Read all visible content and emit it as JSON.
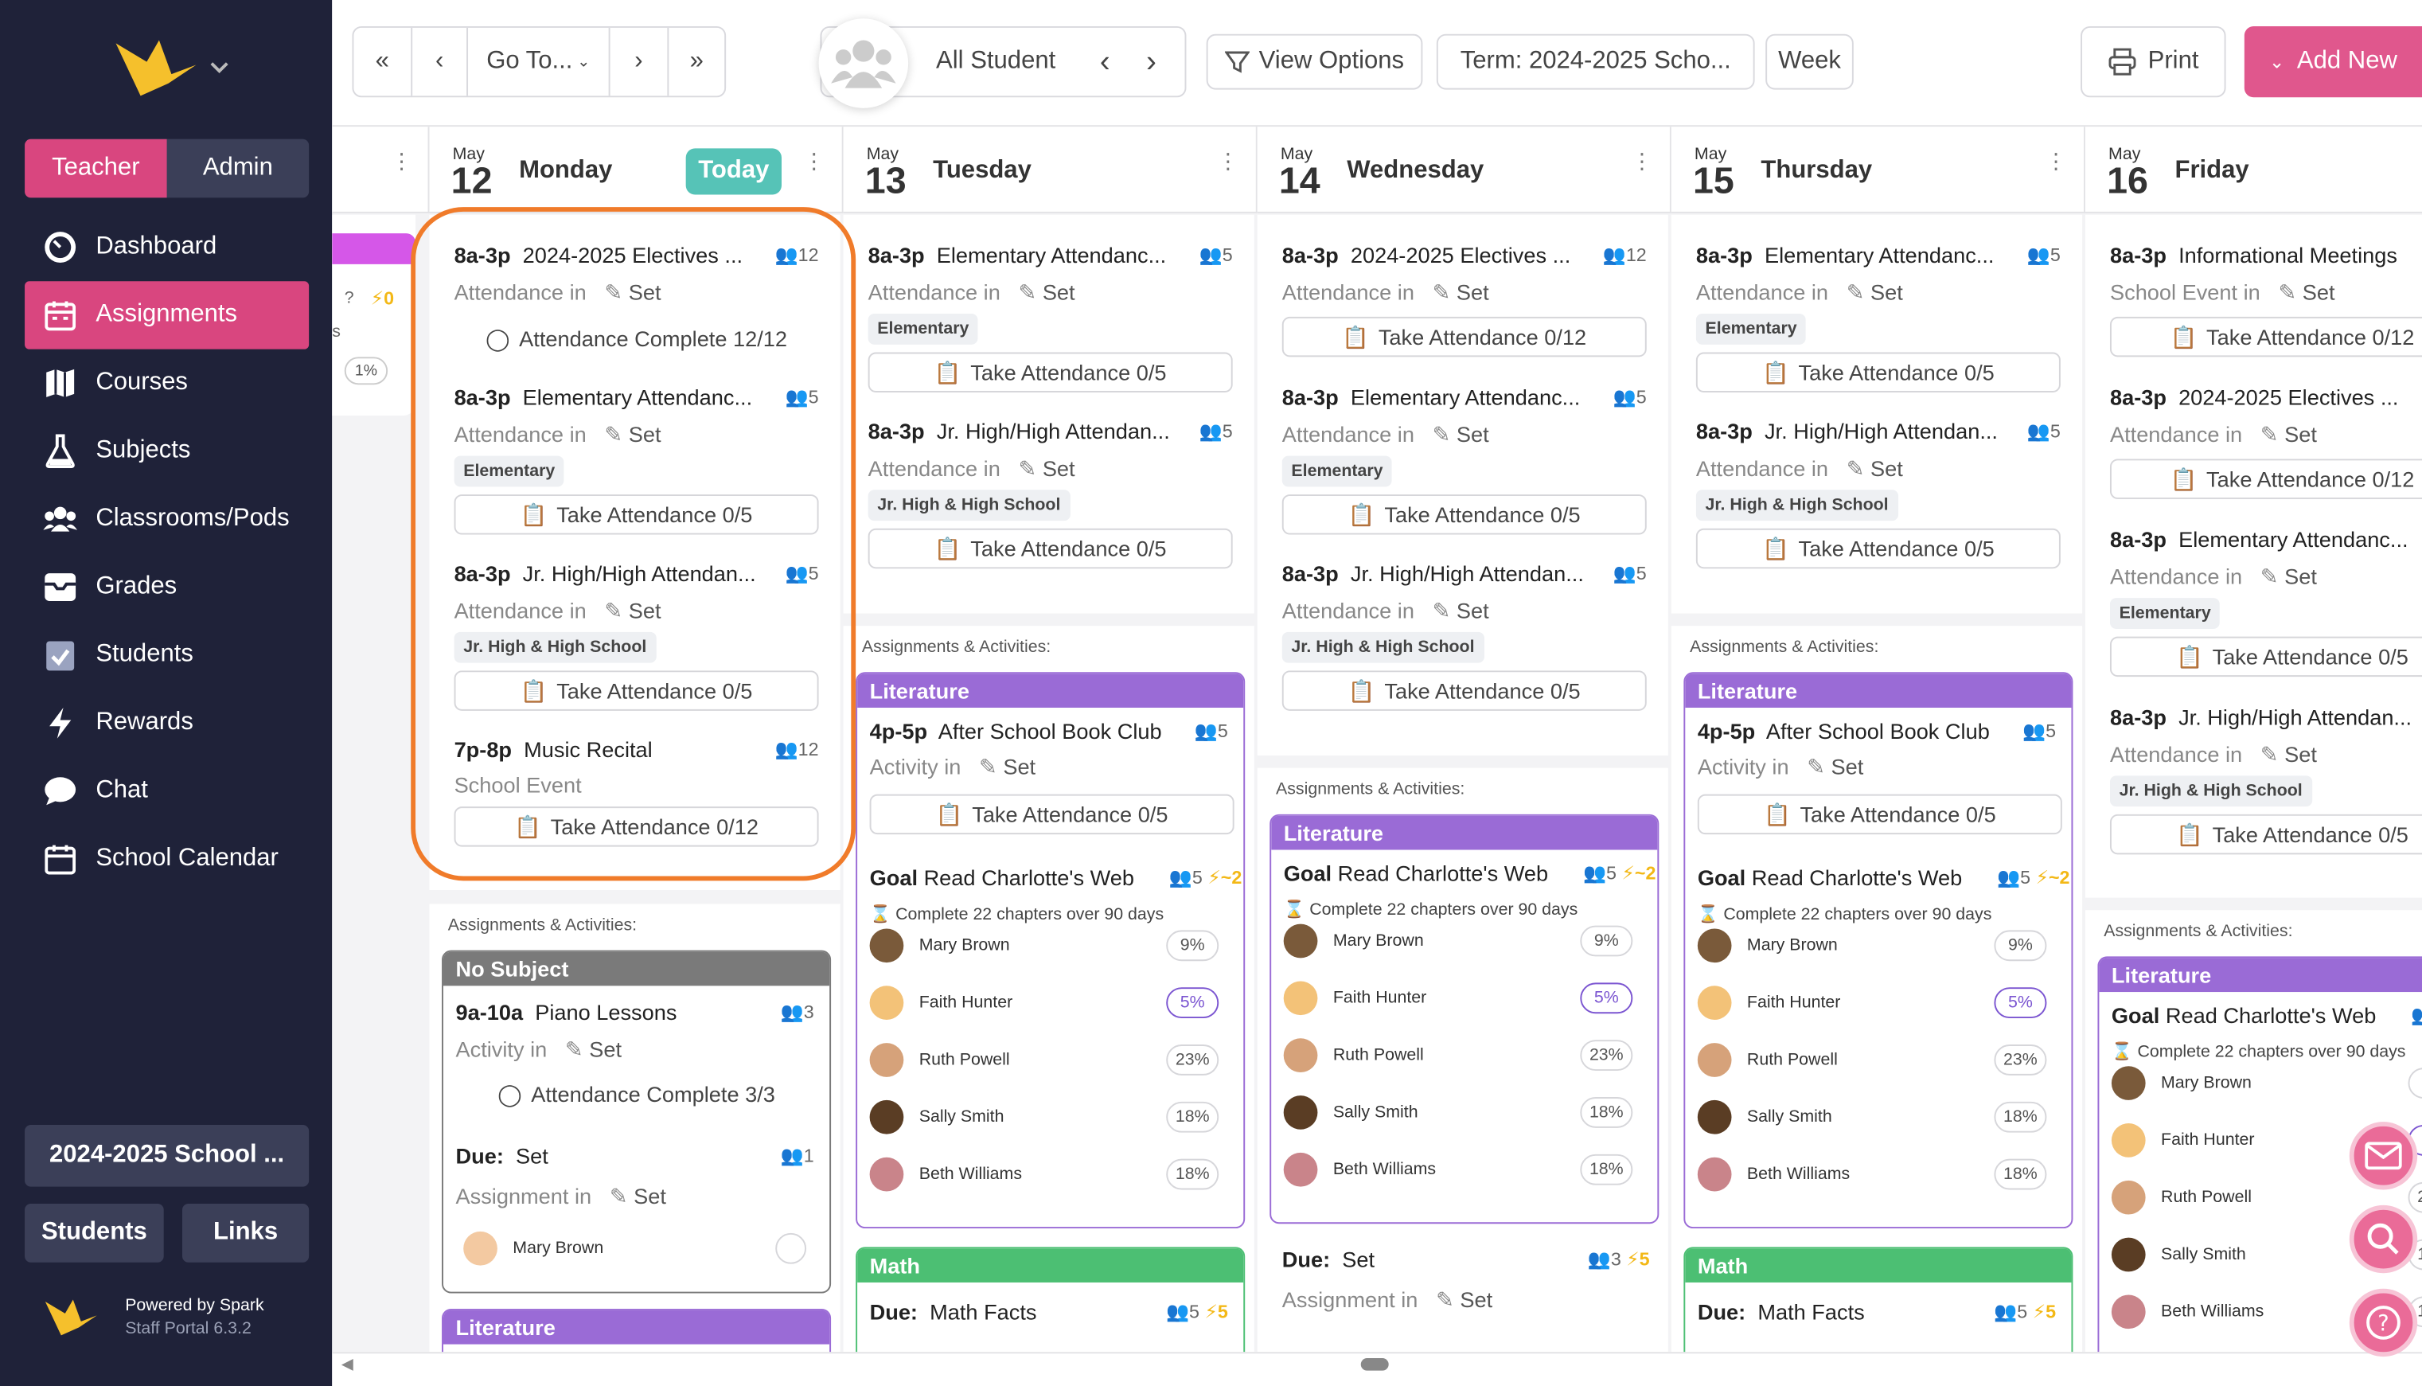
{
  "sidebar": {
    "roles": [
      "Teacher",
      "Admin"
    ],
    "nav": [
      {
        "label": "Dashboard",
        "icon": "dashboard-icon"
      },
      {
        "label": "Assignments",
        "icon": "calendar-icon"
      },
      {
        "label": "Courses",
        "icon": "map-icon"
      },
      {
        "label": "Subjects",
        "icon": "flask-icon"
      },
      {
        "label": "Classrooms/Pods",
        "icon": "group-icon"
      },
      {
        "label": "Grades",
        "icon": "inbox-icon"
      },
      {
        "label": "Students",
        "icon": "check-icon"
      },
      {
        "label": "Rewards",
        "icon": "bolt-icon"
      },
      {
        "label": "Chat",
        "icon": "chat-icon"
      },
      {
        "label": "School Calendar",
        "icon": "calendar-icon"
      }
    ],
    "school_year": "2024-2025 School ...",
    "students": "Students",
    "links": "Links",
    "powered_by": "Powered by Spark",
    "version": "Staff Portal 6.3.2"
  },
  "toolbar": {
    "goto": "Go To...",
    "student_filter": "All Student",
    "view_options": "View Options",
    "term": "Term: 2024-2025 Scho...",
    "week": "Week",
    "print": "Print",
    "add_new": "Add New"
  },
  "prev_col": {
    "bolt": "0",
    "pct": "1%",
    "s": "s"
  },
  "days": [
    {
      "month": "May",
      "num": "12",
      "name": "Monday",
      "today": "Today"
    },
    {
      "month": "May",
      "num": "13",
      "name": "Tuesday"
    },
    {
      "month": "May",
      "num": "14",
      "name": "Wednesday"
    },
    {
      "month": "May",
      "num": "15",
      "name": "Thursday"
    },
    {
      "month": "May",
      "num": "16",
      "name": "Friday"
    }
  ],
  "common": {
    "att_in": "Attendance in",
    "set": "Set",
    "activity_in": "Activity in",
    "assignment_in": "Assignment in",
    "school_event": "School Event",
    "school_event_in": "School Event in",
    "aa": "Assignments & Activities:",
    "elem_tag": "Elementary",
    "jr_tag": "Jr. High & High School",
    "literature": "Literature",
    "math": "Math",
    "no_subject": "No Subject",
    "due": "Due:",
    "goal": "Goal",
    "goal_title": "Read Charlotte's Web",
    "goal_desc": "Complete 22 chapters over 90 days",
    "book_club": "After School Book Club",
    "math_facts": "Math Facts"
  },
  "events": {
    "electives": "2024-2025 Electives ...",
    "elementary": "Elementary Attendanc...",
    "jrhigh": "Jr. High/High Attendan...",
    "recital": "Music Recital",
    "info": "Informational Meetings",
    "piano": "Piano Lessons",
    "time": "8a-3p",
    "time_recital": "7p-8p",
    "time_piano": "9a-10a",
    "time_club": "4p-5p"
  },
  "buttons": {
    "complete_12": "Attendance Complete 12/12",
    "complete_3": "Attendance Complete 3/3",
    "take_0_5": "Take Attendance 0/5",
    "take_0_12": "Take Attendance 0/12"
  },
  "counts": {
    "c12": "12",
    "c5": "5",
    "c3": "3",
    "c1": "1",
    "bolt_2": "~2",
    "bolt_5": "5"
  },
  "students": [
    {
      "name": "Mary Brown",
      "pct": "9%"
    },
    {
      "name": "Faith Hunter",
      "pct": "5%"
    },
    {
      "name": "Ruth Powell",
      "pct": "23%"
    },
    {
      "name": "Sally Smith",
      "pct": "18%"
    },
    {
      "name": "Beth Williams",
      "pct": "18%"
    }
  ],
  "colors": {
    "accent": "#d9467f",
    "sidebar": "#1f2239",
    "today": "#56c3b7",
    "literature": "#9a6bd6",
    "math": "#4cbf73",
    "nosubject": "#7a7a7a",
    "highlight": "#f07b2a"
  }
}
